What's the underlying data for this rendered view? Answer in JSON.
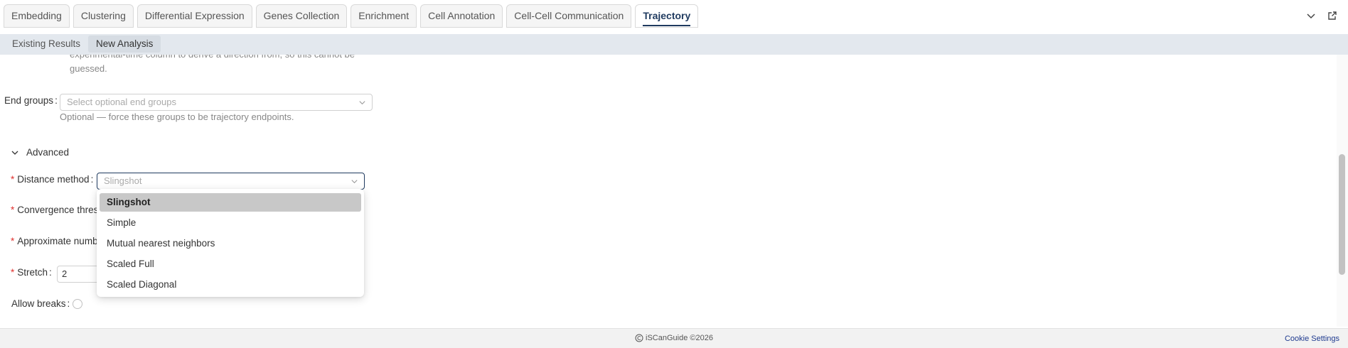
{
  "tabs": [
    {
      "label": "Embedding"
    },
    {
      "label": "Clustering"
    },
    {
      "label": "Differential Expression"
    },
    {
      "label": "Genes Collection"
    },
    {
      "label": "Enrichment"
    },
    {
      "label": "Cell Annotation"
    },
    {
      "label": "Cell-Cell Communication"
    },
    {
      "label": "Trajectory",
      "active": true
    }
  ],
  "subtabs": [
    {
      "label": "Existing Results"
    },
    {
      "label": "New Analysis",
      "active": true
    }
  ],
  "form": {
    "help_top_line1": "experimental-time column to derive a direction from, so this cannot be",
    "help_top_line2": "guessed.",
    "end_groups": {
      "label": "End groups",
      "colon": ":",
      "placeholder": "Select optional end groups",
      "help": "Optional — force these groups to be trajectory endpoints."
    },
    "advanced_label": "Advanced",
    "distance_method": {
      "label": "Distance method",
      "colon": ":",
      "value": "Slingshot"
    },
    "convergence": {
      "label": "Convergence thresh",
      "required": true
    },
    "approximate": {
      "label": "Approximate numbe",
      "required": true
    },
    "stretch": {
      "label": "Stretch",
      "colon": ":",
      "value": "2"
    },
    "allow_breaks": {
      "label": "Allow breaks",
      "colon": ":"
    }
  },
  "dropdown": {
    "options": [
      "Slingshot",
      "Simple",
      "Mutual nearest neighbors",
      "Scaled Full",
      "Scaled Diagonal"
    ],
    "selected": "Slingshot"
  },
  "footer": {
    "brand": "iSCanGuide ©2026",
    "cookie_settings": "Cookie Settings"
  },
  "icons": {
    "tab_collapse": "chevron-down-icon",
    "tab_open_external": "external-link-icon",
    "footer_logo": "copyright-logo-icon"
  },
  "colors": {
    "active_tab_text": "#1f3a5f",
    "required_marker": "#e0322f",
    "subbar_bg": "#e3e8ee",
    "selected_option_bg": "#c8c8c8"
  }
}
